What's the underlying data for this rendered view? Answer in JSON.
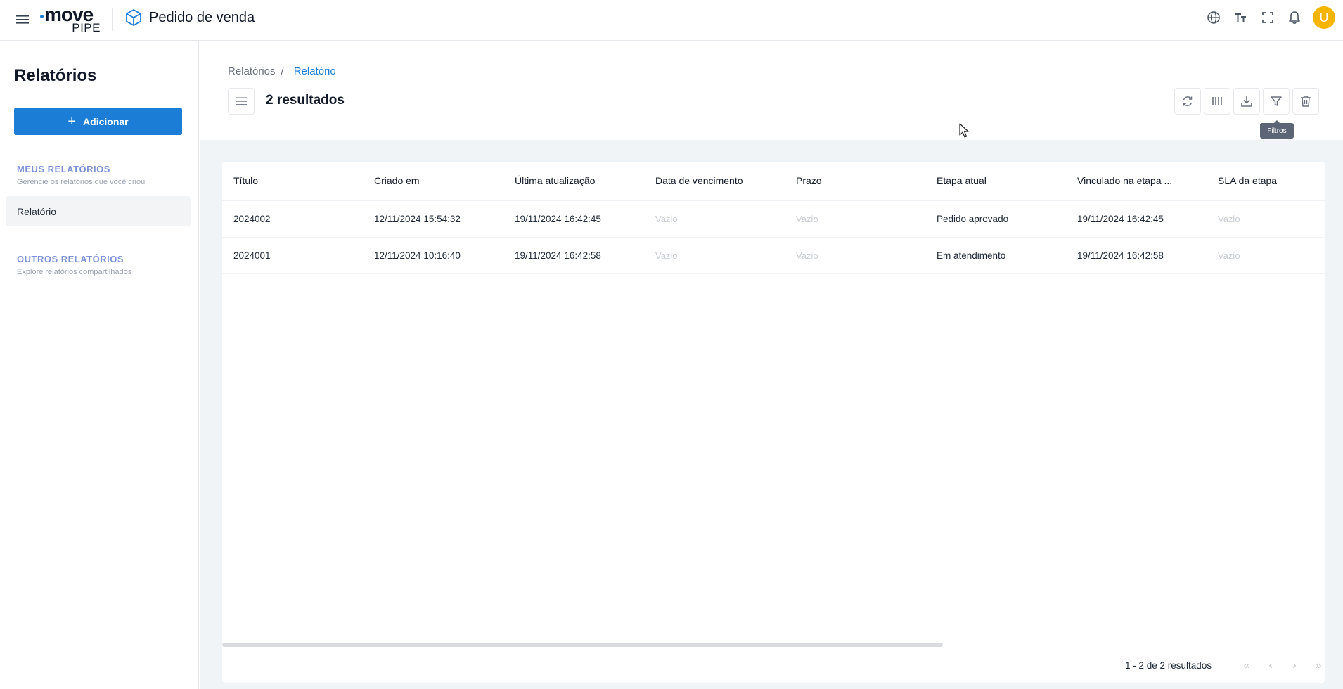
{
  "app": {
    "logo_main": "move",
    "logo_sub": "PIPE",
    "title": "Pedido de venda"
  },
  "user": {
    "avatar_initial": "U",
    "avatar_color": "#f5b400"
  },
  "top_icons": [
    "globe-icon",
    "font-size-icon",
    "fullscreen-icon",
    "bell-icon"
  ],
  "sidebar": {
    "title": "Relatórios",
    "add_label": "Adicionar",
    "my_section": {
      "heading": "MEUS RELATÓRIOS",
      "subtitle": "Gerencie os relatórios que você criou"
    },
    "items": [
      {
        "label": "Relatório"
      }
    ],
    "other_section": {
      "heading": "OUTROS RELATÓRIOS",
      "subtitle": "Explore relatórios compartilhados"
    }
  },
  "breadcrumb": {
    "parent": "Relatórios",
    "separator": "/",
    "current": "Relatório"
  },
  "header": {
    "result_count": "2 resultados"
  },
  "toolbar": {
    "buttons": [
      "refresh-icon",
      "columns-icon",
      "download-icon",
      "filter-icon",
      "trash-icon"
    ],
    "tooltip": "Filtros"
  },
  "table": {
    "columns": [
      "Título",
      "Criado em",
      "Última atualização",
      "Data de vencimento",
      "Prazo",
      "Etapa atual",
      "Vinculado na etapa ...",
      "SLA da etapa"
    ],
    "rows": [
      [
        "2024002",
        "12/11/2024 15:54:32",
        "19/11/2024 16:42:45",
        "Vazio",
        "Vazio",
        "Pedido aprovado",
        "19/11/2024 16:42:45",
        "Vazio"
      ],
      [
        "2024001",
        "12/11/2024 10:16:40",
        "19/11/2024 16:42:58",
        "Vazio",
        "Vazio",
        "Em atendimento",
        "19/11/2024 16:42:58",
        "Vazio"
      ]
    ]
  },
  "pagination": {
    "summary": "1 - 2 de 2 resultados"
  },
  "colors": {
    "accent": "#1c7dd6",
    "section_heading": "#7b93d6",
    "content_bg": "#f1f4f7"
  }
}
